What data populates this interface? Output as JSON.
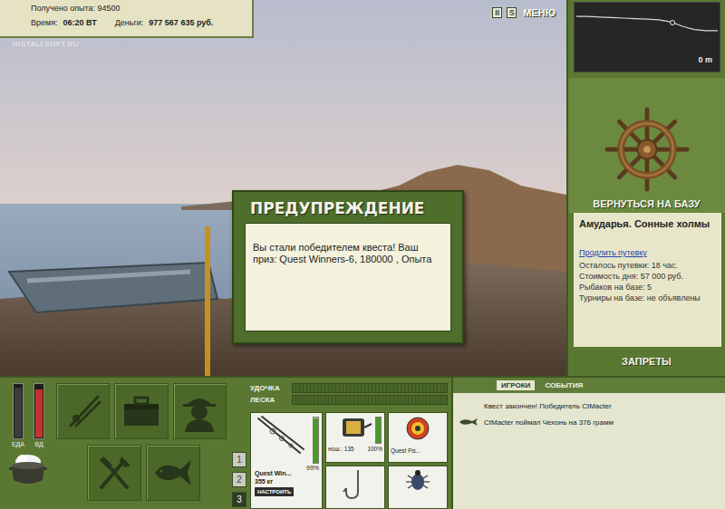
{
  "hud": {
    "experience": "Получено опыта: 94500",
    "time_label": "Время:",
    "time": "06:20 ВТ",
    "money_label": "Деньги:",
    "money": "977 567 635 руб."
  },
  "watermark": "INSTALLSOFT.RU",
  "top_buttons": [
    {
      "label": "II"
    },
    {
      "label": "S"
    },
    {
      "label": "МЕНЮ"
    }
  ],
  "depth": {
    "reading": "0 m",
    "profile": [
      0.12,
      0.12,
      0.13,
      0.14,
      0.15,
      0.16,
      0.17,
      0.18,
      0.22,
      0.3,
      0.36,
      0.38,
      0.38
    ],
    "marker": 0.68
  },
  "base": {
    "button": "ВЕРНУТЬСЯ НА БАЗУ",
    "location": "Амударья. Сонные холмы",
    "extend_link": "Продлить путевку",
    "lines": [
      "Осталось путевки: 18 час.",
      "Стоимость дня: 57 000 руб.",
      "Рыбаков на базе: 5",
      "Турниры на базе: не объявлены"
    ],
    "bans": "ЗАПРЕТЫ"
  },
  "dialog": {
    "title": "ПРЕДУПРЕЖДЕНИЕ",
    "message": "Вы стали победителем квеста! Ваш приз: Quest Winners-6, 180000 , Опыта"
  },
  "status_bars": [
    {
      "label": "ЕДА",
      "level": 0.95,
      "color": "#3c3c3c"
    },
    {
      "label": "ВД",
      "level": 0.92,
      "color": "#c2352a"
    }
  ],
  "pages": [
    {
      "label": "1",
      "selected": false
    },
    {
      "label": "2",
      "selected": false
    },
    {
      "label": "3",
      "selected": true
    }
  ],
  "tension": [
    {
      "label": "УДОЧКА",
      "level": 0
    },
    {
      "label": "ЛЕСКА",
      "level": 0
    }
  ],
  "tackle": {
    "rod": {
      "name": "Quest Win...",
      "weight": "355 кг",
      "reading": "99%",
      "level": 0.99,
      "button": "НАСТРОИТЬ"
    },
    "reel": {
      "load": "нош.: 135",
      "reading": "100%",
      "level": 1
    },
    "lure": {
      "name": "Quest Fis..."
    }
  },
  "chat": {
    "tabs": [
      {
        "label": "ИГРОКИ",
        "selected": true
      },
      {
        "label": "СОБЫТИЯ",
        "selected": false
      }
    ],
    "messages": [
      {
        "text": "Квест закончен! Победитель CtMacter",
        "kind": "system"
      },
      {
        "text": "CtMacter поймал Чехонь на 376 грамм",
        "kind": "catch"
      }
    ]
  }
}
